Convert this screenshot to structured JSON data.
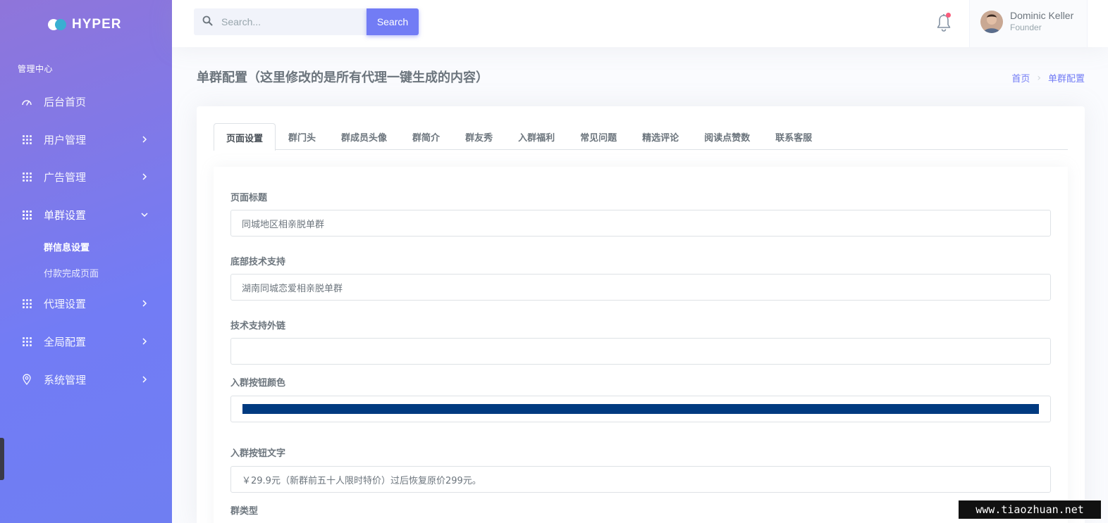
{
  "brand": {
    "name": "HYPER"
  },
  "sidebar": {
    "section_title": "管理中心",
    "items": [
      {
        "label": "后台首页",
        "icon": "dashboard-icon"
      },
      {
        "label": "用户管理",
        "icon": "grid-icon"
      },
      {
        "label": "广告管理",
        "icon": "grid-icon"
      },
      {
        "label": "单群设置",
        "icon": "grid-icon",
        "expanded": true,
        "children": [
          {
            "label": "群信息设置",
            "active": true
          },
          {
            "label": "付款完成页面"
          }
        ]
      },
      {
        "label": "代理设置",
        "icon": "grid-icon"
      },
      {
        "label": "全局配置",
        "icon": "grid-icon"
      },
      {
        "label": "系统管理",
        "icon": "map-pin-icon"
      }
    ]
  },
  "topbar": {
    "search_placeholder": "Search...",
    "search_button": "Search",
    "user": {
      "name": "Dominic Keller",
      "role": "Founder"
    }
  },
  "page": {
    "title": "单群配置（这里修改的是所有代理一键生成的内容）",
    "breadcrumb": [
      "首页",
      "单群配置"
    ]
  },
  "tabs": [
    "页面设置",
    "群门头",
    "群成员头像",
    "群简介",
    "群友秀",
    "入群福利",
    "常见问题",
    "精选评论",
    "阅读点赞数",
    "联系客服"
  ],
  "form": {
    "page_title_label": "页面标题",
    "page_title_value": "同城地区相亲脱单群",
    "footer_support_label": "底部技术支持",
    "footer_support_value": "湖南同城恋爱相亲脱单群",
    "support_link_label": "技术支持外链",
    "support_link_value": "",
    "button_color_label": "入群按钮颜色",
    "button_color_value": "#003a80",
    "button_text_label": "入群按钮文字",
    "button_text_value": "￥29.9元（新群前五十人限时特价）过后恢复原价299元。",
    "group_type_label": "群类型"
  },
  "colors": {
    "accent": "#727cf5",
    "sidebar_start": "#8f75da",
    "notification": "#fa5c7c"
  },
  "watermark": "www.tiaozhuan.net"
}
